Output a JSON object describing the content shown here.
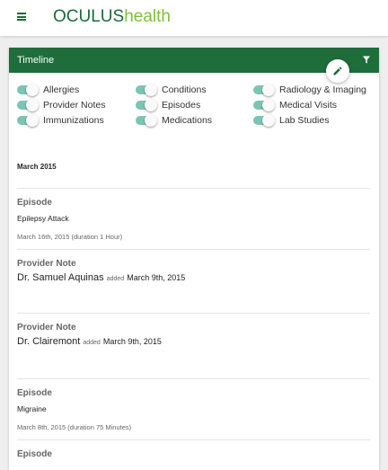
{
  "app": {
    "logo_part1": "OCULUS",
    "logo_part2": "health"
  },
  "colors": {
    "header_green": "#1f6d3b",
    "logo_dark": "#1b6b3a",
    "logo_light": "#7cbf3a",
    "toggle_on": "#7cc4b4"
  },
  "card": {
    "title": "Timeline"
  },
  "toggles": [
    {
      "label": "Allergies",
      "on": true
    },
    {
      "label": "Conditions",
      "on": true
    },
    {
      "label": "Radiology & Imaging",
      "on": true
    },
    {
      "label": "Provider Notes",
      "on": true
    },
    {
      "label": "Episodes",
      "on": true
    },
    {
      "label": "Medical Visits",
      "on": true
    },
    {
      "label": "Immunizations",
      "on": true
    },
    {
      "label": "Medications",
      "on": true
    },
    {
      "label": "Lab Studies",
      "on": true
    }
  ],
  "month": "March 2015",
  "entries": [
    {
      "type": "Episode",
      "title": "Epilepsy Attack",
      "meta": "March 16th, 2015 (duration 1 Hour)"
    },
    {
      "type": "Provider Note",
      "name": "Dr. Samuel Aquinas",
      "added": "added",
      "date": "March 9th, 2015"
    },
    {
      "type": "Provider Note",
      "name": "Dr. Clairemont",
      "added": "added",
      "date": "March 9th, 2015"
    },
    {
      "type": "Episode",
      "title": "Migraine",
      "meta": "March 8th, 2015 (duration 75 Minutes)"
    },
    {
      "type": "Episode"
    }
  ]
}
